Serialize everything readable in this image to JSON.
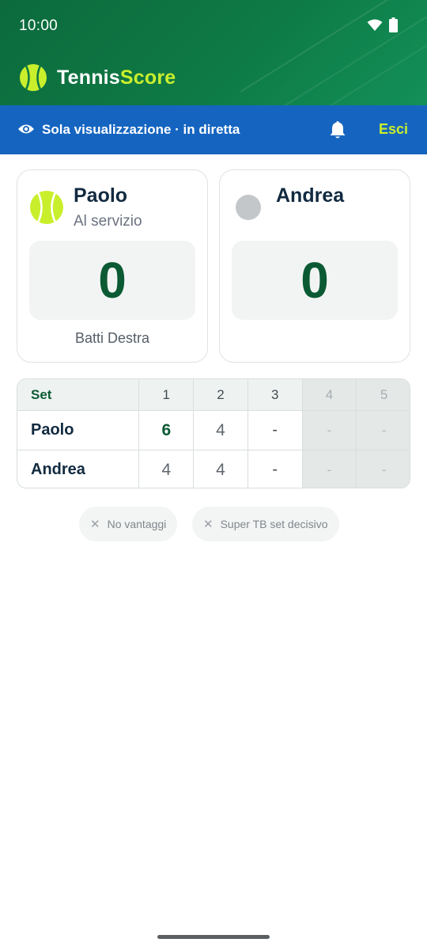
{
  "status_bar": {
    "time": "10:00"
  },
  "app": {
    "name_part1": "Tennis",
    "name_part2": "Score"
  },
  "live_bar": {
    "text": "Sola visualizzazione · in diretta",
    "exit_label": "Esci",
    "icons": [
      "eye-icon",
      "bell-icon"
    ]
  },
  "players": [
    {
      "name": "Paolo",
      "status": "Al servizio",
      "points": "0",
      "serve_side": "Batti Destra",
      "serving": true
    },
    {
      "name": "Andrea",
      "status": "",
      "points": "0",
      "serve_side": "",
      "serving": false
    }
  ],
  "sets_table": {
    "header_label": "Set",
    "set_numbers": [
      "1",
      "2",
      "3",
      "4",
      "5"
    ],
    "rows": [
      {
        "player": "Paolo",
        "scores": [
          "6",
          "4",
          "-",
          "-",
          "-"
        ]
      },
      {
        "player": "Andrea",
        "scores": [
          "4",
          "4",
          "-",
          "-",
          "-"
        ]
      }
    ]
  },
  "rule_chips": [
    {
      "label": "No vantaggi",
      "icon": "close-icon"
    },
    {
      "label": "Super TB set decisivo",
      "icon": "close-icon"
    }
  ],
  "colors": {
    "header_green": "#0e7a45",
    "live_blue": "#1565c0",
    "accent_lime": "#c9ef2c",
    "score_green": "#0b5a34"
  }
}
